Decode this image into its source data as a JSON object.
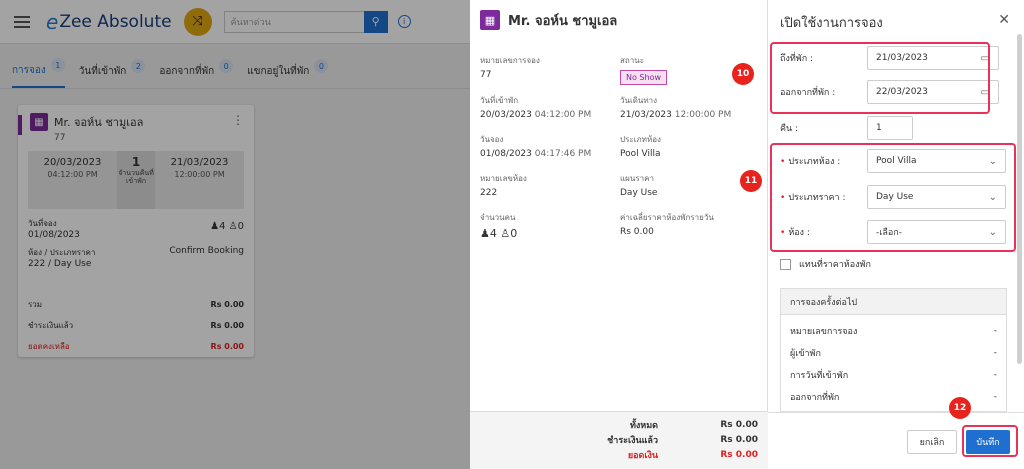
{
  "app": {
    "logo_e": "e",
    "logo_text": "Zee Absolute",
    "search_placeholder": "ค้นหาด่วน",
    "tabs": [
      {
        "label": "การจอง",
        "count": "1"
      },
      {
        "label": "วันที่เข้าพัก",
        "count": "2"
      },
      {
        "label": "ออกจากที่พัก",
        "count": "0"
      },
      {
        "label": "แขกอยู่ในที่พัก",
        "count": "0"
      }
    ]
  },
  "card": {
    "guest": "Mr. จอห์น ชามูเอล",
    "id": "77",
    "arrival_date": "20/03/2023",
    "arrival_time": "04:12:00 PM",
    "nights": "1",
    "nights_label": "จำนวนคืนที่เข้าพัก",
    "departure_date": "21/03/2023",
    "departure_time": "12:00:00 PM",
    "booking_date_label": "วันที่จอง",
    "booking_date": "01/08/2023",
    "adults": "4",
    "children": "0",
    "room_rate_label": "ห้อง / ประเภทราคา",
    "room_rate": "222 / Day Use",
    "status": "Confirm Booking",
    "totals": [
      {
        "label": "รวม",
        "value": "Rs 0.00"
      },
      {
        "label": "ชำระเงินแล้ว",
        "value": "Rs 0.00"
      },
      {
        "label": "ยอดคงเหลือ",
        "value": "Rs 0.00"
      }
    ]
  },
  "detail": {
    "guest": "Mr. จอห์น ชามูเอล",
    "reservation_no_label": "หมายเลขการจอง",
    "reservation_no": "77",
    "status_label": "สถานะ",
    "status": "No Show",
    "arrival_label": "วันที่เข้าพัก",
    "arrival_date": "20/03/2023",
    "arrival_time": "04:12:00 PM",
    "departure_label": "วันเดินทาง",
    "departure_date": "21/03/2023",
    "departure_time": "12:00:00 PM",
    "booking_date_label": "วันจอง",
    "booking_date": "01/08/2023",
    "booking_time": "04:17:46 PM",
    "room_type_label": "ประเภทห้อง",
    "room_type": "Pool Villa",
    "room_no_label": "หมายเลขห้อง",
    "room_no": "222",
    "rate_plan_label": "แผนราคา",
    "rate_plan": "Day Use",
    "pax_label": "จำนวนคน",
    "adults": "4",
    "children": "0",
    "avg_rate_label": "ค่าเฉลี่ยราคาห้องพักรายวัน",
    "avg_rate": "Rs 0.00",
    "footer": [
      {
        "label": "ทั้งหมด",
        "value": "Rs 0.00"
      },
      {
        "label": "ชำระเงินแล้ว",
        "value": "Rs 0.00"
      },
      {
        "label": "ยอดเงิน",
        "value": "Rs 0.00"
      }
    ]
  },
  "form": {
    "title": "เปิดใช้งานการจอง",
    "checkin_label": "ถึงที่พัก :",
    "checkin": "21/03/2023",
    "checkout_label": "ออกจากที่พัก :",
    "checkout": "22/03/2023",
    "nights_label": "คืน :",
    "nights": "1",
    "room_type_label": "ประเภทห้อง :",
    "room_type": "Pool Villa",
    "rate_type_label": "ประเภทราคา :",
    "rate_type": "Day Use",
    "room_label": "ห้อง :",
    "room": "-เลือก-",
    "override_label": "แทนที่ราคาห้องพัก",
    "next_head": "การจองครั้งต่อไป",
    "next_rows": [
      {
        "label": "หมายเลขการจอง",
        "value": "-"
      },
      {
        "label": "ผู้เข้าพัก",
        "value": "-"
      },
      {
        "label": "การวันที่เข้าพัก",
        "value": "-"
      },
      {
        "label": "ออกจากที่พัก",
        "value": "-"
      }
    ],
    "cancel": "ยกเลิก",
    "save": "บันทึก"
  },
  "markers": [
    "10",
    "11",
    "12"
  ],
  "colors": {
    "accent": "#1f6fd0",
    "highlight": "#e8325a",
    "marker": "#e8221c",
    "room_icon": "#7d2a9c",
    "balance": "#dd2222"
  }
}
